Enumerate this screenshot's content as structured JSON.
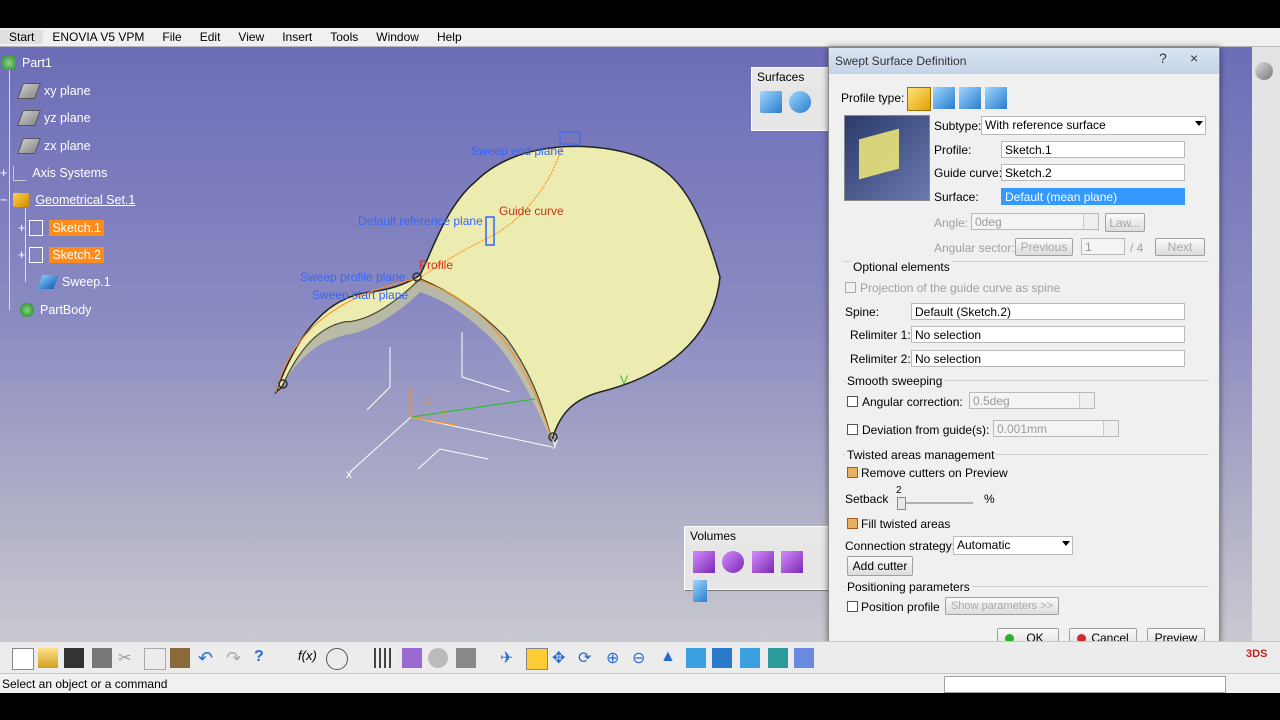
{
  "menubar": {
    "items": [
      "Start",
      "ENOVIA V5 VPM",
      "File",
      "Edit",
      "View",
      "Insert",
      "Tools",
      "Window",
      "Help"
    ]
  },
  "tree": {
    "root": "Part1",
    "xy_plane": "xy plane",
    "yz_plane": "yz plane",
    "zx_plane": "zx plane",
    "axis_systems": "Axis Systems",
    "geometrical_set": "Geometrical Set.1",
    "sketch1": "Sketch.1",
    "sketch2": "Sketch.2",
    "sweep": "Sweep.1",
    "partbody": "PartBody"
  },
  "viewport_labels": {
    "sweep_end_plane": "Sweep end plane",
    "guide_curve": "Guide curve",
    "default_reference_plane": "Default reference plane",
    "profile": "Profile",
    "sweep_profile_plane": "Sweep profile plane",
    "sweep_start_plane": "Sweep start plane",
    "axis_h1": "H",
    "axis_h2": "H",
    "axis_x": "x",
    "axis_y": "y",
    "axis_v": "V"
  },
  "surfaces_panel": {
    "title": "Surfaces"
  },
  "volumes_panel": {
    "title": "Volumes"
  },
  "dialog": {
    "title": "Swept Surface Definition",
    "help": "?",
    "close": "×",
    "profile_type_label": "Profile type:",
    "subtype_label": "Subtype:",
    "subtype_value": "With reference surface",
    "profile_label": "Profile:",
    "profile_value": "Sketch.1",
    "guide_label": "Guide curve:",
    "guide_value": "Sketch.2",
    "surface_label": "Surface:",
    "surface_value": "Default (mean plane)",
    "angle_label": "Angle:",
    "angle_value": "0deg",
    "law_button": "Law...",
    "angular_sector_label": "Angular sector:",
    "previous_button": "Previous",
    "sector_value": "1",
    "sector_total": "/ 4",
    "next_button": "Next",
    "optional_elements": "Optional elements",
    "projection_label": "Projection of the guide curve as spine",
    "spine_label": "Spine:",
    "spine_value": "Default (Sketch.2)",
    "relimiter1_label": "Relimiter 1:",
    "relimiter1_value": "No selection",
    "relimiter2_label": "Relimiter 2:",
    "relimiter2_value": "No selection",
    "smooth_sweeping": "Smooth sweeping",
    "angular_correction_label": "Angular correction:",
    "angular_correction_value": "0.5deg",
    "deviation_label": "Deviation from guide(s):",
    "deviation_value": "0.001mm",
    "twisted_areas": "Twisted areas management",
    "remove_cutters": "Remove cutters on Preview",
    "setback_label": "Setback",
    "setback_value": "2",
    "setback_unit": "%",
    "fill_twisted": "Fill twisted areas",
    "connection_label": "Connection strategy:",
    "connection_value": "Automatic",
    "add_cutter": "Add cutter",
    "positioning": "Positioning parameters",
    "position_profile": "Position profile",
    "show_parameters": "Show parameters >>",
    "ok": "OK",
    "cancel": "Cancel",
    "preview": "Preview"
  },
  "status": {
    "text": "Select an object or a command"
  },
  "colors": {
    "highlight": "#ff8c1a",
    "selection": "#3399ff",
    "surface": "#ecebb0"
  }
}
